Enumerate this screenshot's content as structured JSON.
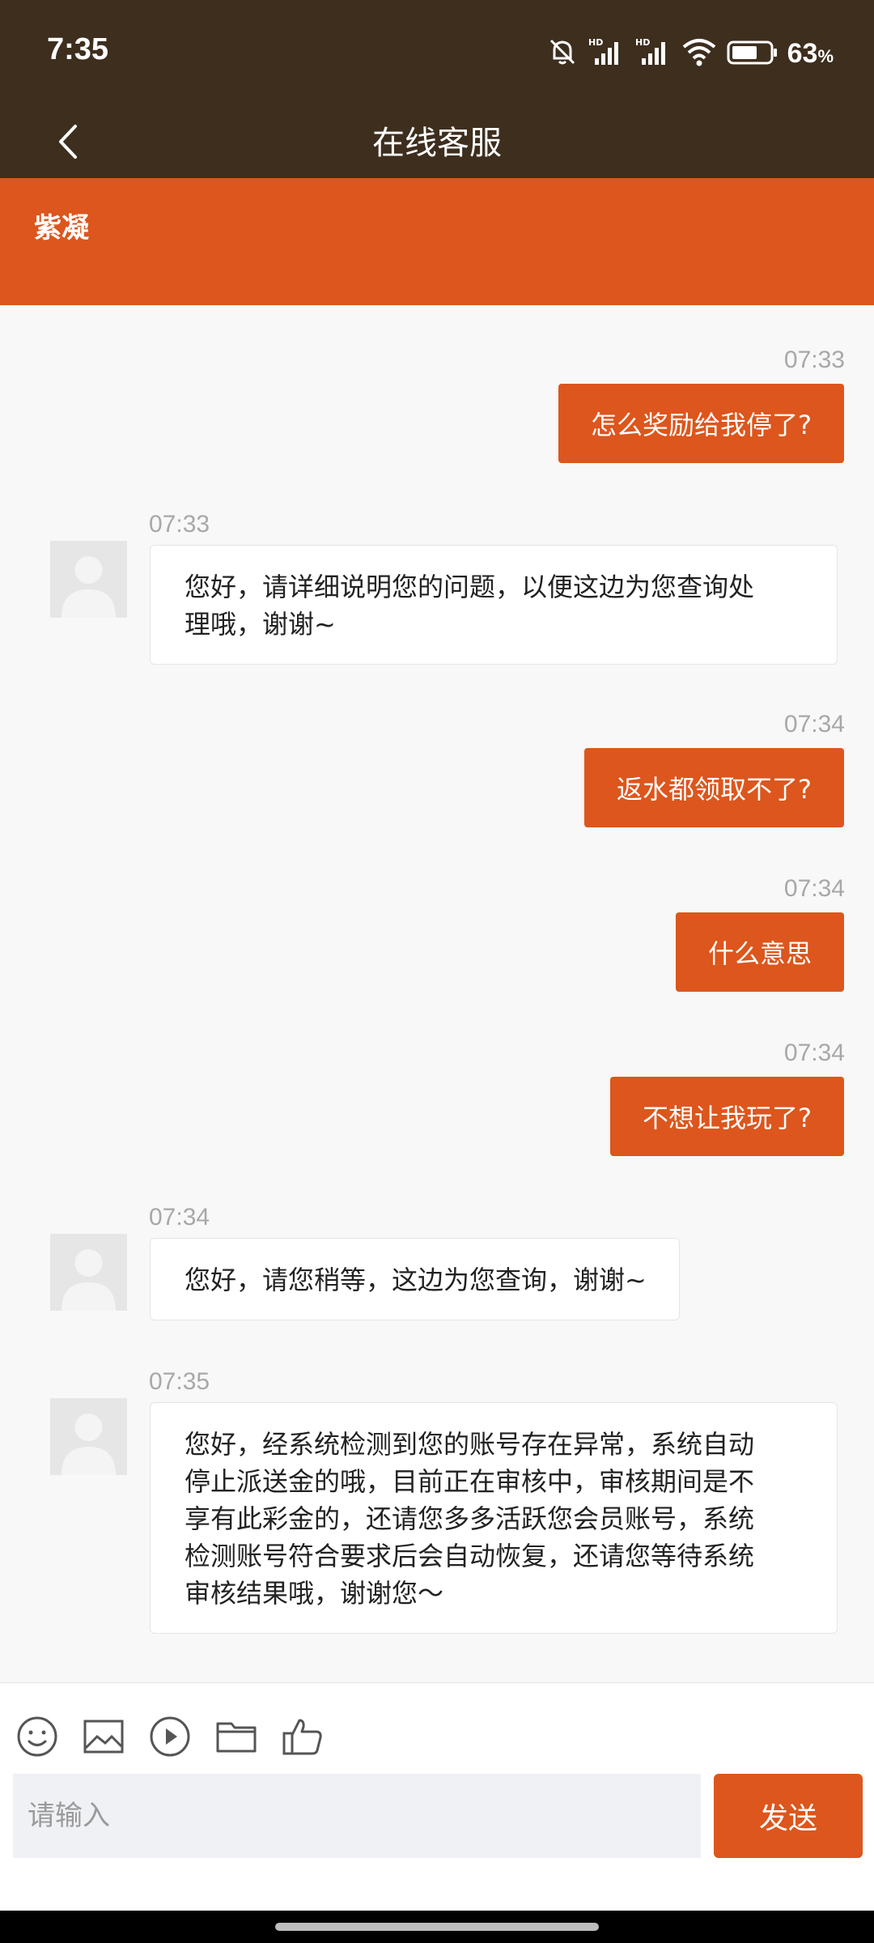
{
  "status_bar": {
    "time": "7:35",
    "battery_percent": "63",
    "battery_unit": "%",
    "icons": [
      "mute-bell-icon",
      "hd-signal-icon",
      "hd-signal-icon",
      "wifi-icon",
      "battery-icon"
    ]
  },
  "header": {
    "title": "在线客服",
    "back_icon": "chevron-left-icon"
  },
  "agent": {
    "name": "紫凝"
  },
  "messages": [
    {
      "dir": "out",
      "time": "07:33",
      "text": "怎么奖励给我停了?"
    },
    {
      "dir": "in",
      "time": "07:33",
      "lines": [
        "您好，请详细说明您的问题，以便这边为您查询处",
        "理哦，谢谢~"
      ]
    },
    {
      "dir": "out",
      "time": "07:34",
      "text": "返水都领取不了?"
    },
    {
      "dir": "out",
      "time": "07:34",
      "text": "什么意思"
    },
    {
      "dir": "out",
      "time": "07:34",
      "text": "不想让我玩了?"
    },
    {
      "dir": "in",
      "time": "07:34",
      "lines": [
        "您好，请您稍等，这边为您查询，谢谢~"
      ]
    },
    {
      "dir": "in",
      "time": "07:35",
      "lines": [
        "您好，经系统检测到您的账号存在异常，系统自动",
        "停止派送金的哦，目前正在审核中，审核期间是不",
        "享有此彩金的，还请您多多活跃您会员账号，系统",
        "检测账号符合要求后会自动恢复，还请您等待系统",
        "审核结果哦，谢谢您～"
      ]
    }
  ],
  "toolbar": {
    "icons": [
      "emoji-icon",
      "image-icon",
      "video-play-icon",
      "folder-icon",
      "thumbs-up-icon"
    ]
  },
  "composer": {
    "placeholder": "请输入",
    "send_label": "发送"
  },
  "colors": {
    "header_bg": "#3d2e1e",
    "accent": "#dc561d",
    "chat_bg": "#f8f8f8"
  }
}
